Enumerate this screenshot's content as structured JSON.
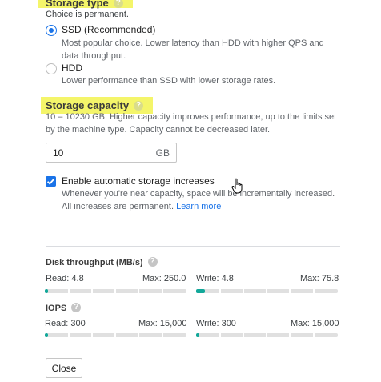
{
  "storage_type": {
    "title": "Storage type",
    "subtitle": "Choice is permanent.",
    "options": [
      {
        "label": "SSD (Recommended)",
        "description": "Most popular choice. Lower latency than HDD with higher QPS and data throughput.",
        "selected": true
      },
      {
        "label": "HDD",
        "description": "Lower performance than SSD with lower storage rates.",
        "selected": false
      }
    ]
  },
  "storage_capacity": {
    "title": "Storage capacity",
    "description": "10 – 10230 GB. Higher capacity improves performance, up to the limits set by the machine type. Capacity cannot be decreased later.",
    "value": "10",
    "unit": "GB",
    "auto_increase": {
      "label": "Enable automatic storage increases",
      "description": "Whenever you're near capacity, space will be incrementally increased. All increases are permanent.",
      "link": "Learn more",
      "checked": true
    }
  },
  "disk_throughput": {
    "title": "Disk throughput (MB/s)",
    "read_label": "Read: 4.8",
    "read_max": "Max: 250.0",
    "read_fraction": 0.02,
    "write_label": "Write: 4.8",
    "write_max": "Max: 75.8",
    "write_fraction": 0.06
  },
  "iops": {
    "title": "IOPS",
    "read_label": "Read: 300",
    "read_max": "Max: 15,000",
    "read_fraction": 0.02,
    "write_label": "Write: 300",
    "write_max": "Max: 15,000",
    "write_fraction": 0.02
  },
  "close_label": "Close",
  "help_glyph": "?",
  "colors": {
    "accent": "#1a73e8",
    "bar_fill": "#12a89a",
    "highlight": "#f4f56a"
  }
}
